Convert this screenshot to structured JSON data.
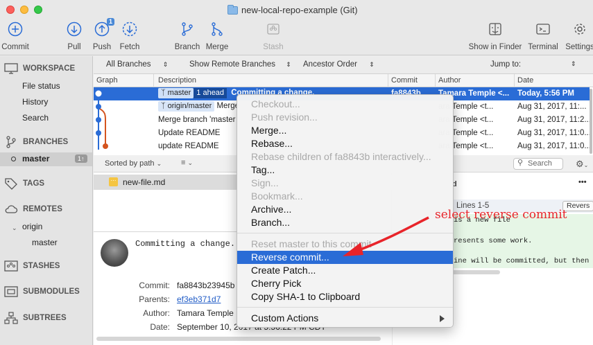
{
  "window": {
    "title": "new-local-repo-example (Git)"
  },
  "toolbar": {
    "commit": "Commit",
    "pull": "Pull",
    "push": "Push",
    "push_badge": "1",
    "fetch": "Fetch",
    "branch": "Branch",
    "merge": "Merge",
    "stash": "Stash",
    "show_in_finder": "Show in Finder",
    "terminal": "Terminal",
    "settings": "Settings"
  },
  "sidebar": {
    "workspace": "WORKSPACE",
    "file_status": "File status",
    "history": "History",
    "search": "Search",
    "branches": "BRANCHES",
    "branch_master": "master",
    "branch_count": "1↑",
    "tags": "TAGS",
    "remotes": "REMOTES",
    "remote_origin": "origin",
    "remote_master": "master",
    "stashes": "STASHES",
    "submodules": "SUBMODULES",
    "subtrees": "SUBTREES"
  },
  "filterbar": {
    "all_branches": "All Branches",
    "show_remote": "Show Remote Branches",
    "ancestor_order": "Ancestor Order",
    "jump_to": "Jump to:"
  },
  "columns": {
    "graph": "Graph",
    "description": "Description",
    "commit": "Commit",
    "author": "Author",
    "date": "Date"
  },
  "commits": [
    {
      "branch": "master",
      "ahead": "1 ahead",
      "description": "Committing a change.",
      "commit": "fa8843b",
      "author": "Tamara Temple <...",
      "date": "Today, 5:56 PM"
    },
    {
      "branch": "origin/master",
      "description": "Merge",
      "commit": "",
      "author": "ara Temple <t...",
      "date": "Aug 31, 2017, 11:..."
    },
    {
      "description": "Merge branch 'master",
      "commit": "",
      "author": "ara Temple <t...",
      "date": "Aug 31, 2017, 11:2..."
    },
    {
      "description": "Update README",
      "commit": "",
      "author": "ara Temple <t...",
      "date": "Aug 31, 2017, 11:0..."
    },
    {
      "description": "update README",
      "commit": "",
      "author": "ara Temple <t...",
      "date": "Aug 31, 2017, 11:0..."
    }
  ],
  "lower_left": {
    "sorted_by": "Sorted by path",
    "file": "new-file.md",
    "message": "Committing a change.",
    "commit_label": "Commit:",
    "commit_value": "fa8843b23945b",
    "parents_label": "Parents:",
    "parents_value": "ef3eb371d7",
    "author_label": "Author:",
    "author_value": "Tamara Temple",
    "date_label": "Date:",
    "date_value": "September 10, 2017 at 5:56:22 PM CDT"
  },
  "lower_right": {
    "search_placeholder": "Search",
    "file_title": "d",
    "more": "•••",
    "hunk": "Lines 1-5",
    "reverse_btn": "Revers",
    "line1": "is a new file",
    "line2": "resents some work.",
    "line3": "ine will be committed, but then re"
  },
  "context_menu": {
    "checkout": "Checkout...",
    "push_revision": "Push revision...",
    "merge": "Merge...",
    "rebase": "Rebase...",
    "rebase_children": "Rebase children of fa8843b interactively...",
    "tag": "Tag...",
    "sign": "Sign...",
    "bookmark": "Bookmark...",
    "archive": "Archive...",
    "branch": "Branch...",
    "reset_master": "Reset master to this commit",
    "reverse_commit": "Reverse commit...",
    "create_patch": "Create Patch...",
    "cherry_pick": "Cherry Pick",
    "copy_sha": "Copy SHA-1 to Clipboard",
    "custom_actions": "Custom Actions"
  },
  "annotation": {
    "text": "select reverse commit",
    "color": "#e8242a"
  },
  "colors": {
    "selection": "#2a6cd6",
    "graph_blue": "#2a6cd6",
    "graph_orange": "#d4541e"
  }
}
